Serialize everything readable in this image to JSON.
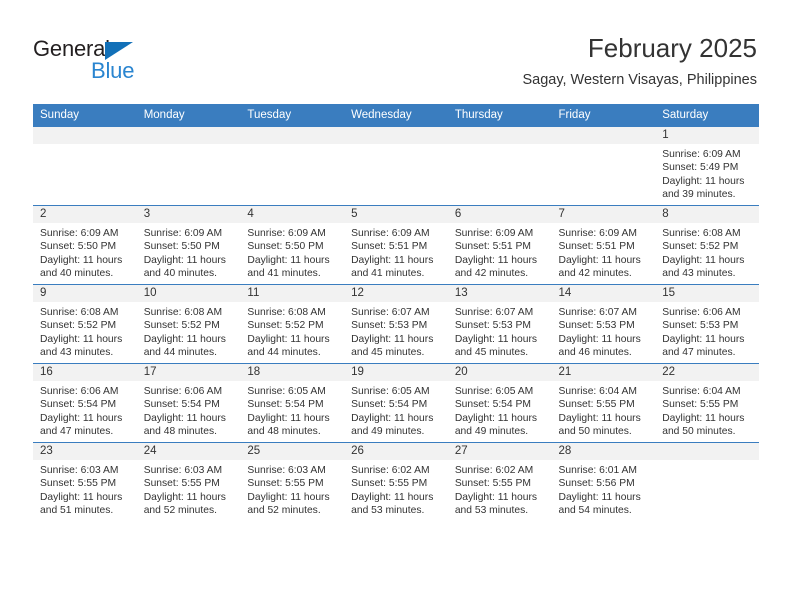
{
  "brand": {
    "name_top": "General",
    "name_bottom": "Blue",
    "accent_color": "#2a85d0",
    "triangle_color": "#1270b8"
  },
  "header": {
    "title": "February 2025",
    "subtitle": "Sagay, Western Visayas, Philippines"
  },
  "theme": {
    "header_blue": "#3a7dbf",
    "daynum_band": "#f2f2f2",
    "text": "#333333"
  },
  "calendar": {
    "weekday_headers": [
      "Sunday",
      "Monday",
      "Tuesday",
      "Wednesday",
      "Thursday",
      "Friday",
      "Saturday"
    ],
    "weeks": [
      [
        {
          "day": "",
          "empty": true,
          "sunrise": "",
          "sunset": "",
          "daylight1": "",
          "daylight2": ""
        },
        {
          "day": "",
          "empty": true,
          "sunrise": "",
          "sunset": "",
          "daylight1": "",
          "daylight2": ""
        },
        {
          "day": "",
          "empty": true,
          "sunrise": "",
          "sunset": "",
          "daylight1": "",
          "daylight2": ""
        },
        {
          "day": "",
          "empty": true,
          "sunrise": "",
          "sunset": "",
          "daylight1": "",
          "daylight2": ""
        },
        {
          "day": "",
          "empty": true,
          "sunrise": "",
          "sunset": "",
          "daylight1": "",
          "daylight2": ""
        },
        {
          "day": "",
          "empty": true,
          "sunrise": "",
          "sunset": "",
          "daylight1": "",
          "daylight2": ""
        },
        {
          "day": "1",
          "empty": false,
          "sunrise": "Sunrise: 6:09 AM",
          "sunset": "Sunset: 5:49 PM",
          "daylight1": "Daylight: 11 hours",
          "daylight2": "and 39 minutes."
        }
      ],
      [
        {
          "day": "2",
          "empty": false,
          "sunrise": "Sunrise: 6:09 AM",
          "sunset": "Sunset: 5:50 PM",
          "daylight1": "Daylight: 11 hours",
          "daylight2": "and 40 minutes."
        },
        {
          "day": "3",
          "empty": false,
          "sunrise": "Sunrise: 6:09 AM",
          "sunset": "Sunset: 5:50 PM",
          "daylight1": "Daylight: 11 hours",
          "daylight2": "and 40 minutes."
        },
        {
          "day": "4",
          "empty": false,
          "sunrise": "Sunrise: 6:09 AM",
          "sunset": "Sunset: 5:50 PM",
          "daylight1": "Daylight: 11 hours",
          "daylight2": "and 41 minutes."
        },
        {
          "day": "5",
          "empty": false,
          "sunrise": "Sunrise: 6:09 AM",
          "sunset": "Sunset: 5:51 PM",
          "daylight1": "Daylight: 11 hours",
          "daylight2": "and 41 minutes."
        },
        {
          "day": "6",
          "empty": false,
          "sunrise": "Sunrise: 6:09 AM",
          "sunset": "Sunset: 5:51 PM",
          "daylight1": "Daylight: 11 hours",
          "daylight2": "and 42 minutes."
        },
        {
          "day": "7",
          "empty": false,
          "sunrise": "Sunrise: 6:09 AM",
          "sunset": "Sunset: 5:51 PM",
          "daylight1": "Daylight: 11 hours",
          "daylight2": "and 42 minutes."
        },
        {
          "day": "8",
          "empty": false,
          "sunrise": "Sunrise: 6:08 AM",
          "sunset": "Sunset: 5:52 PM",
          "daylight1": "Daylight: 11 hours",
          "daylight2": "and 43 minutes."
        }
      ],
      [
        {
          "day": "9",
          "empty": false,
          "sunrise": "Sunrise: 6:08 AM",
          "sunset": "Sunset: 5:52 PM",
          "daylight1": "Daylight: 11 hours",
          "daylight2": "and 43 minutes."
        },
        {
          "day": "10",
          "empty": false,
          "sunrise": "Sunrise: 6:08 AM",
          "sunset": "Sunset: 5:52 PM",
          "daylight1": "Daylight: 11 hours",
          "daylight2": "and 44 minutes."
        },
        {
          "day": "11",
          "empty": false,
          "sunrise": "Sunrise: 6:08 AM",
          "sunset": "Sunset: 5:52 PM",
          "daylight1": "Daylight: 11 hours",
          "daylight2": "and 44 minutes."
        },
        {
          "day": "12",
          "empty": false,
          "sunrise": "Sunrise: 6:07 AM",
          "sunset": "Sunset: 5:53 PM",
          "daylight1": "Daylight: 11 hours",
          "daylight2": "and 45 minutes."
        },
        {
          "day": "13",
          "empty": false,
          "sunrise": "Sunrise: 6:07 AM",
          "sunset": "Sunset: 5:53 PM",
          "daylight1": "Daylight: 11 hours",
          "daylight2": "and 45 minutes."
        },
        {
          "day": "14",
          "empty": false,
          "sunrise": "Sunrise: 6:07 AM",
          "sunset": "Sunset: 5:53 PM",
          "daylight1": "Daylight: 11 hours",
          "daylight2": "and 46 minutes."
        },
        {
          "day": "15",
          "empty": false,
          "sunrise": "Sunrise: 6:06 AM",
          "sunset": "Sunset: 5:53 PM",
          "daylight1": "Daylight: 11 hours",
          "daylight2": "and 47 minutes."
        }
      ],
      [
        {
          "day": "16",
          "empty": false,
          "sunrise": "Sunrise: 6:06 AM",
          "sunset": "Sunset: 5:54 PM",
          "daylight1": "Daylight: 11 hours",
          "daylight2": "and 47 minutes."
        },
        {
          "day": "17",
          "empty": false,
          "sunrise": "Sunrise: 6:06 AM",
          "sunset": "Sunset: 5:54 PM",
          "daylight1": "Daylight: 11 hours",
          "daylight2": "and 48 minutes."
        },
        {
          "day": "18",
          "empty": false,
          "sunrise": "Sunrise: 6:05 AM",
          "sunset": "Sunset: 5:54 PM",
          "daylight1": "Daylight: 11 hours",
          "daylight2": "and 48 minutes."
        },
        {
          "day": "19",
          "empty": false,
          "sunrise": "Sunrise: 6:05 AM",
          "sunset": "Sunset: 5:54 PM",
          "daylight1": "Daylight: 11 hours",
          "daylight2": "and 49 minutes."
        },
        {
          "day": "20",
          "empty": false,
          "sunrise": "Sunrise: 6:05 AM",
          "sunset": "Sunset: 5:54 PM",
          "daylight1": "Daylight: 11 hours",
          "daylight2": "and 49 minutes."
        },
        {
          "day": "21",
          "empty": false,
          "sunrise": "Sunrise: 6:04 AM",
          "sunset": "Sunset: 5:55 PM",
          "daylight1": "Daylight: 11 hours",
          "daylight2": "and 50 minutes."
        },
        {
          "day": "22",
          "empty": false,
          "sunrise": "Sunrise: 6:04 AM",
          "sunset": "Sunset: 5:55 PM",
          "daylight1": "Daylight: 11 hours",
          "daylight2": "and 50 minutes."
        }
      ],
      [
        {
          "day": "23",
          "empty": false,
          "sunrise": "Sunrise: 6:03 AM",
          "sunset": "Sunset: 5:55 PM",
          "daylight1": "Daylight: 11 hours",
          "daylight2": "and 51 minutes."
        },
        {
          "day": "24",
          "empty": false,
          "sunrise": "Sunrise: 6:03 AM",
          "sunset": "Sunset: 5:55 PM",
          "daylight1": "Daylight: 11 hours",
          "daylight2": "and 52 minutes."
        },
        {
          "day": "25",
          "empty": false,
          "sunrise": "Sunrise: 6:03 AM",
          "sunset": "Sunset: 5:55 PM",
          "daylight1": "Daylight: 11 hours",
          "daylight2": "and 52 minutes."
        },
        {
          "day": "26",
          "empty": false,
          "sunrise": "Sunrise: 6:02 AM",
          "sunset": "Sunset: 5:55 PM",
          "daylight1": "Daylight: 11 hours",
          "daylight2": "and 53 minutes."
        },
        {
          "day": "27",
          "empty": false,
          "sunrise": "Sunrise: 6:02 AM",
          "sunset": "Sunset: 5:55 PM",
          "daylight1": "Daylight: 11 hours",
          "daylight2": "and 53 minutes."
        },
        {
          "day": "28",
          "empty": false,
          "sunrise": "Sunrise: 6:01 AM",
          "sunset": "Sunset: 5:56 PM",
          "daylight1": "Daylight: 11 hours",
          "daylight2": "and 54 minutes."
        },
        {
          "day": "",
          "empty": true,
          "sunrise": "",
          "sunset": "",
          "daylight1": "",
          "daylight2": ""
        }
      ]
    ]
  }
}
